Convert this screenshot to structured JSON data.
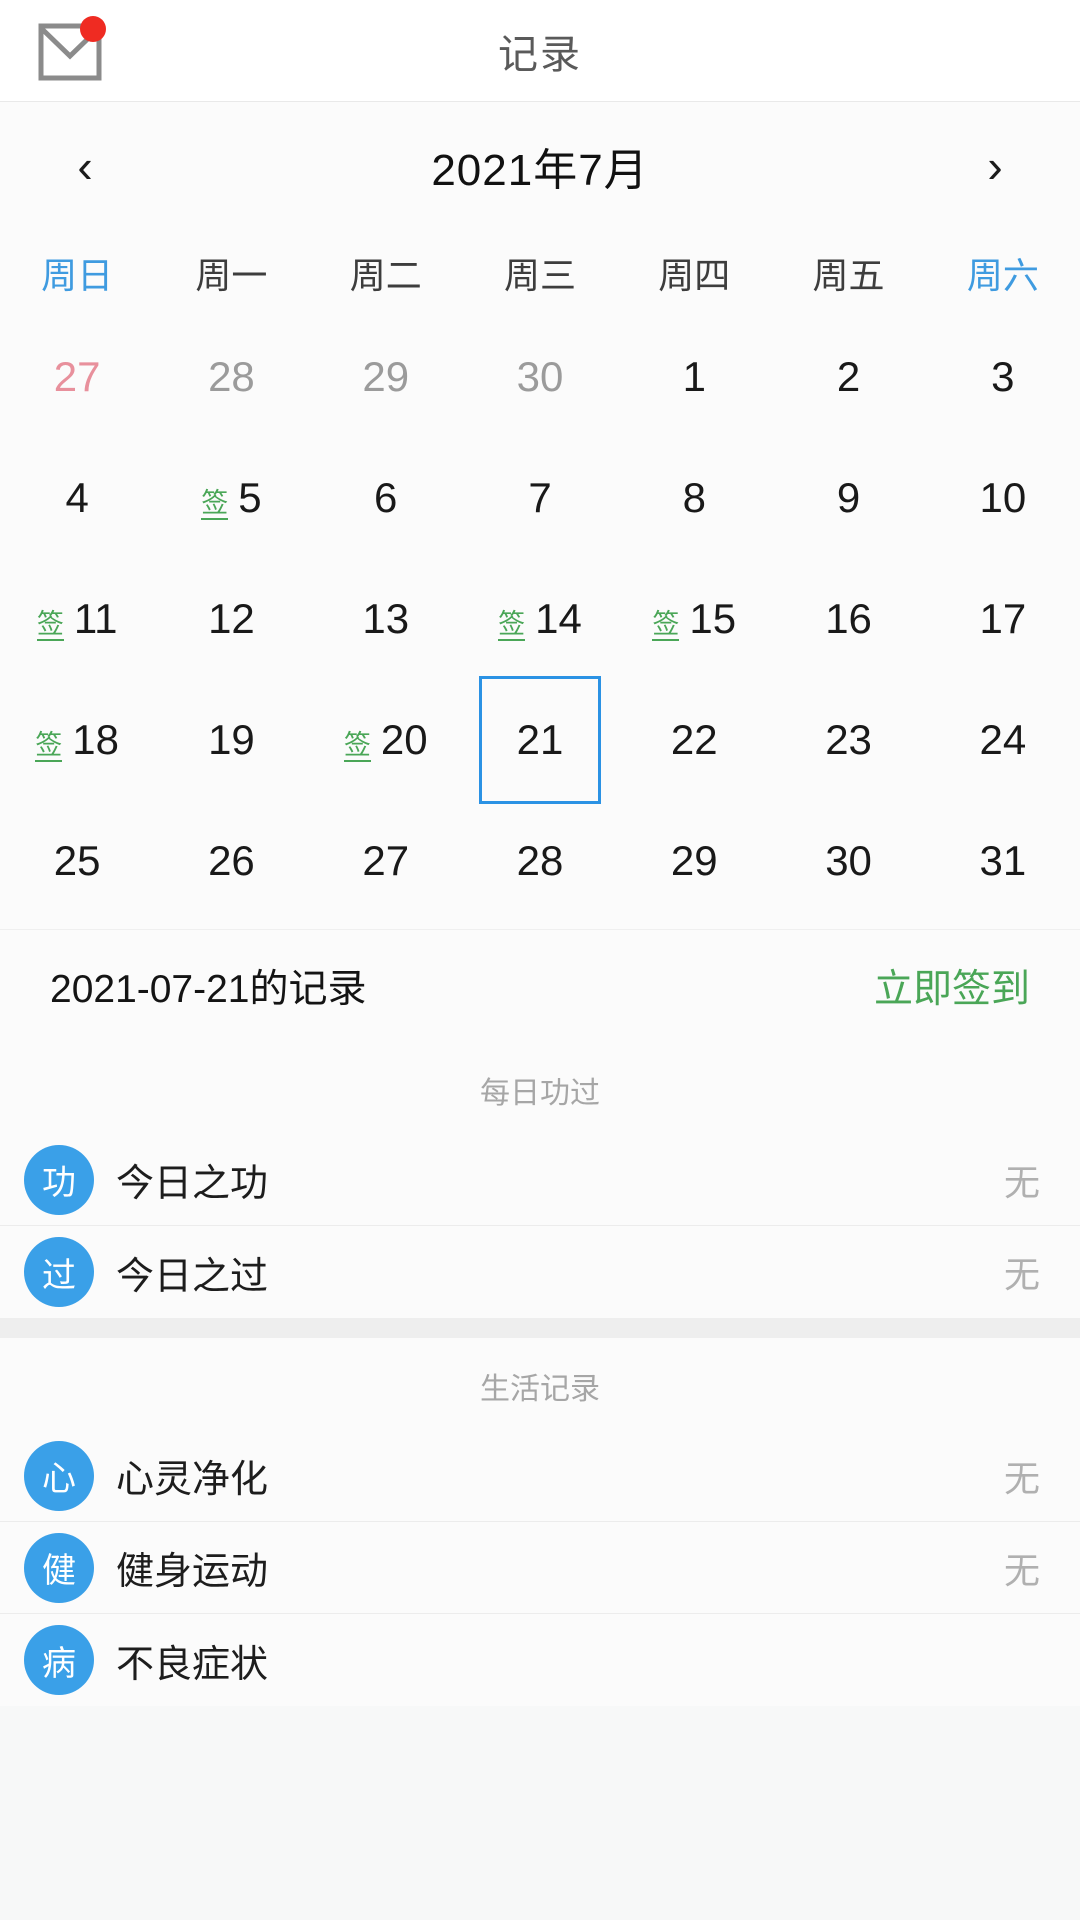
{
  "header": {
    "title": "记录",
    "mail_icon": "mail-icon",
    "badge_color": "#ef2b22",
    "has_unread_badge": true
  },
  "calendar": {
    "prev_label": "‹",
    "next_label": "›",
    "month_label": "2021年7月",
    "weekdays": [
      "周日",
      "周一",
      "周二",
      "周三",
      "周四",
      "周五",
      "周六"
    ],
    "weekend_color": "#3f9be0",
    "sign_mark": "签",
    "sign_color": "#4aa657",
    "selected_day": 21,
    "selection_color": "#2b92e4",
    "weeks": [
      [
        {
          "day": "27",
          "type": "prev-weekend",
          "signed": false
        },
        {
          "day": "28",
          "type": "muted",
          "signed": false
        },
        {
          "day": "29",
          "type": "muted",
          "signed": false
        },
        {
          "day": "30",
          "type": "muted",
          "signed": false
        },
        {
          "day": "1",
          "type": "current",
          "signed": false
        },
        {
          "day": "2",
          "type": "current",
          "signed": false
        },
        {
          "day": "3",
          "type": "current",
          "signed": false
        }
      ],
      [
        {
          "day": "4",
          "type": "current",
          "signed": false
        },
        {
          "day": "5",
          "type": "current",
          "signed": true
        },
        {
          "day": "6",
          "type": "current",
          "signed": false
        },
        {
          "day": "7",
          "type": "current",
          "signed": false
        },
        {
          "day": "8",
          "type": "current",
          "signed": false
        },
        {
          "day": "9",
          "type": "current",
          "signed": false
        },
        {
          "day": "10",
          "type": "current",
          "signed": false
        }
      ],
      [
        {
          "day": "11",
          "type": "current",
          "signed": true
        },
        {
          "day": "12",
          "type": "current",
          "signed": false
        },
        {
          "day": "13",
          "type": "current",
          "signed": false
        },
        {
          "day": "14",
          "type": "current",
          "signed": true
        },
        {
          "day": "15",
          "type": "current",
          "signed": true
        },
        {
          "day": "16",
          "type": "current",
          "signed": false
        },
        {
          "day": "17",
          "type": "current",
          "signed": false
        }
      ],
      [
        {
          "day": "18",
          "type": "current",
          "signed": true
        },
        {
          "day": "19",
          "type": "current",
          "signed": false
        },
        {
          "day": "20",
          "type": "current",
          "signed": true
        },
        {
          "day": "21",
          "type": "current",
          "signed": false,
          "selected": true
        },
        {
          "day": "22",
          "type": "current",
          "signed": false
        },
        {
          "day": "23",
          "type": "current",
          "signed": false
        },
        {
          "day": "24",
          "type": "current",
          "signed": false
        }
      ],
      [
        {
          "day": "25",
          "type": "current",
          "signed": false
        },
        {
          "day": "26",
          "type": "current",
          "signed": false
        },
        {
          "day": "27",
          "type": "current",
          "signed": false
        },
        {
          "day": "28",
          "type": "current",
          "signed": false
        },
        {
          "day": "29",
          "type": "current",
          "signed": false
        },
        {
          "day": "30",
          "type": "current",
          "signed": false
        },
        {
          "day": "31",
          "type": "current",
          "signed": false
        }
      ]
    ]
  },
  "record_bar": {
    "title": "2021-07-21的记录",
    "action_label": "立即签到",
    "action_color": "#4aa657"
  },
  "sections": [
    {
      "title": "每日功过",
      "items": [
        {
          "badge": "功",
          "label": "今日之功",
          "value": "无"
        },
        {
          "badge": "过",
          "label": "今日之过",
          "value": "无"
        }
      ]
    },
    {
      "title": "生活记录",
      "items": [
        {
          "badge": "心",
          "label": "心灵净化",
          "value": "无"
        },
        {
          "badge": "健",
          "label": "健身运动",
          "value": "无"
        },
        {
          "badge": "病",
          "label": "不良症状",
          "value": ""
        }
      ]
    }
  ]
}
